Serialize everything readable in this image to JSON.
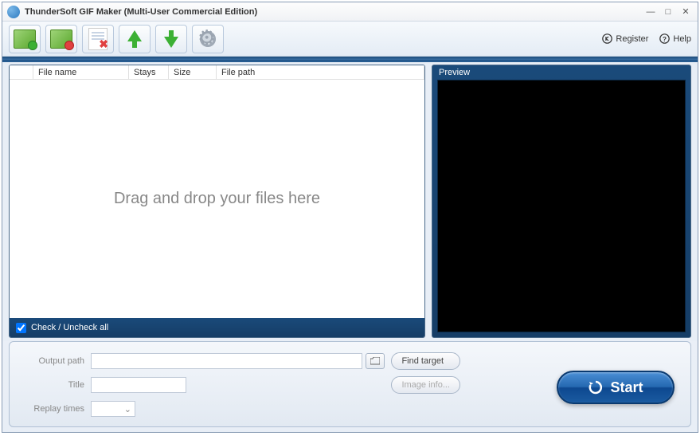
{
  "title": "ThunderSoft GIF Maker (Multi-User Commercial Edition)",
  "toolbar": {
    "register": "Register",
    "help": "Help"
  },
  "list": {
    "headers": {
      "filename": "File name",
      "stays": "Stays",
      "size": "Size",
      "filepath": "File path"
    },
    "placeholder": "Drag and drop your files here",
    "checkall": "Check / Uncheck all"
  },
  "preview": {
    "label": "Preview"
  },
  "form": {
    "output_path_label": "Output path",
    "output_path_value": "",
    "find_target": "Find target",
    "title_label": "Title",
    "title_value": "",
    "image_info": "Image info...",
    "replay_label": "Replay times",
    "replay_value": ""
  },
  "start": "Start"
}
